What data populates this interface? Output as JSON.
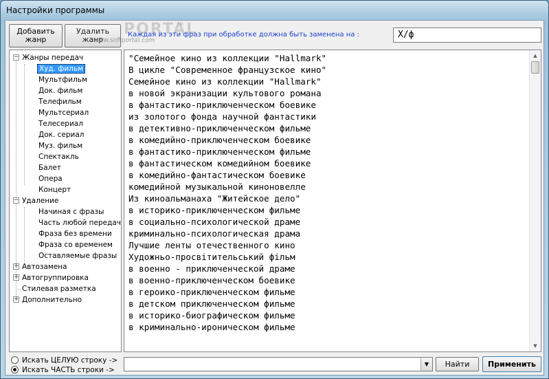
{
  "window": {
    "title": "Настройки программы"
  },
  "toolbar": {
    "add_genre_l1": "Добавить",
    "add_genre_l2": "жанр",
    "delete_genre_l1": "Удалить",
    "delete_genre_l2": "жанр",
    "hint": "Каждая из эти фраз  при обработке должна быть заменена на :",
    "replace_value": "Х/ф",
    "watermark": "PORTAL",
    "watermark_tm": "TM",
    "watermark_url": "www.softportal.com"
  },
  "tree": {
    "genres": {
      "label": "Жанры передач",
      "items": [
        "Худ. фильм",
        "Мультфильм",
        "Док. фильм",
        "Телефильм",
        "Мультсериал",
        "Телесериал",
        "Док. сериал",
        "Муз. фильм",
        "Спектакль",
        "Балет",
        "Опера",
        "Концерт"
      ],
      "selected": "Худ. фильм"
    },
    "removal": {
      "label": "Удаление",
      "items": [
        "Начиная с фразы",
        "Часть любой передачи",
        "Фраза без времени",
        "Фраза со временем",
        "Оставляемые фразы"
      ]
    },
    "autoreplace": "Автозамена",
    "autogroup": "Автогруппировка",
    "style": "Стилевая разметка",
    "extra": "Дополнительно"
  },
  "editor": {
    "lines": [
      "\"Семейное кино из коллекции \"Hallmark\"",
      "В цикле \"Современное французское кино\"",
      "Семейное кино из коллекции \"Hallmark\"",
      "в новой экранизации культового романа",
      "в фантастико-приключенческом боевике",
      "из золотого фонда научной фантастики",
      "в детективно-приключенческом фильме",
      "в комедийно-приключенческом боевике",
      "в фантастико-приключенческом фильме",
      "в фантастическом комедийном боевике",
      "в комедийно-фантастическом боевике",
      "комедийной музыкальной киноновелле",
      "Из киноальманаха \"Житейское дело\"",
      "в историко-приключенческом фильме",
      "в социально-психологической драме",
      "криминально-психологическая драма",
      "Лучшие ленты отечественного кино",
      "Художньо-просвітительський фільм",
      "в военно - приключенческой драме",
      "в военно-приключенческом боевике",
      "в героико-приключенческом фильме",
      "в детском приключенческом фильме",
      "в историко-биографическом фильме",
      "в криминально-ироническом фильме"
    ]
  },
  "bottom": {
    "opt_whole": "Искать ЦЕЛУЮ строку ->",
    "opt_part": "Искать ЧАСТЬ  строки ->",
    "search_value": "",
    "find_label": "Найти",
    "apply_label": "Применить"
  },
  "colors": {
    "selection": "#3399ff",
    "hint": "#1a3fcf"
  }
}
